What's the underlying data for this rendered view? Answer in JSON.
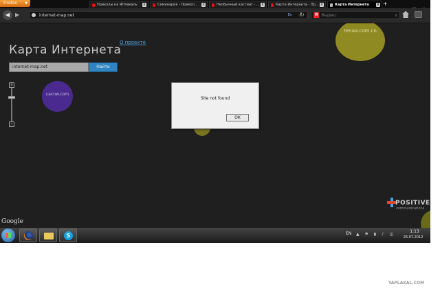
{
  "browser": {
    "menu_label": "Firefox",
    "tabs": [
      {
        "label": "Приколы на ЯПлакаль",
        "active": false
      },
      {
        "label": "Семинария - Прикол...",
        "active": false
      },
      {
        "label": "Необычный кастинг - ...",
        "active": false
      },
      {
        "label": "Карта Интернета - Пр...",
        "active": false
      },
      {
        "label": "Карта Интернета",
        "active": true
      }
    ],
    "new_tab": "+",
    "url": "internet-map.net",
    "lang_indicator": "En",
    "search_placeholder": "Яндекс"
  },
  "page": {
    "title": "Карта Интернета",
    "about_link": "О проекте",
    "search_input_value": "internet-map.net",
    "search_button": "Найти",
    "nodes": {
      "cacnw": "cacnw.com",
      "tenaa": "tenaa.com.cn"
    },
    "google_mark": "Google",
    "logo_main": "POSITIVE",
    "logo_sub": "communications"
  },
  "dialog": {
    "message": "Site not found",
    "ok_label": "OK"
  },
  "taskbar": {
    "lang": "EN",
    "time": "1:13",
    "date": "26.07.2012"
  },
  "footer_watermark": "YAPLAKAL.COM"
}
